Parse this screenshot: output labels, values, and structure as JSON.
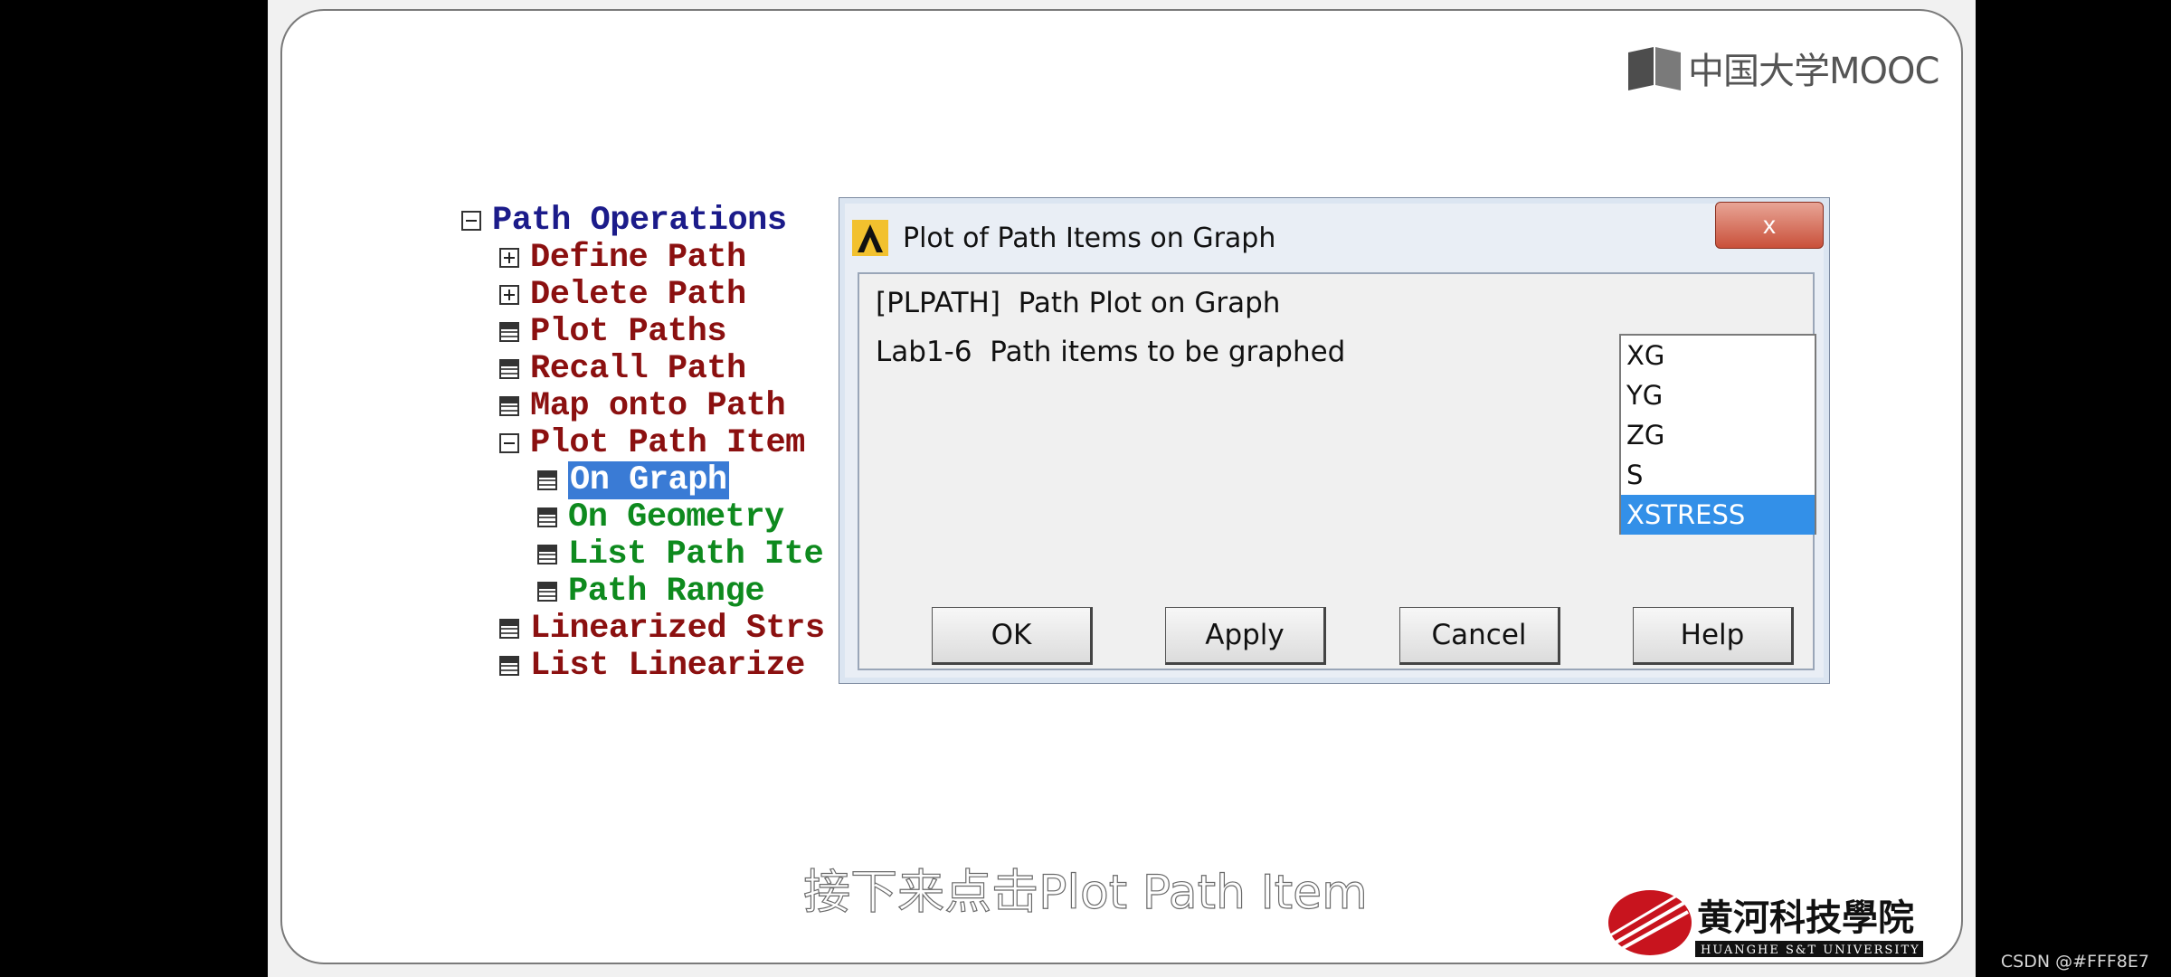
{
  "mooc_logo": {
    "text": "中国大学MOOC"
  },
  "tree": {
    "items": [
      {
        "label": "Path Operations",
        "icon": "collapse-box-icon"
      },
      {
        "label": "Define Path",
        "icon": "expand-box-icon"
      },
      {
        "label": "Delete Path",
        "icon": "expand-box-icon"
      },
      {
        "label": "Plot Paths",
        "icon": "command-doc-icon"
      },
      {
        "label": "Recall Path",
        "icon": "command-doc-icon"
      },
      {
        "label": "Map onto Path",
        "icon": "command-doc-icon"
      },
      {
        "label": "Plot Path Item",
        "icon": "collapse-box-icon"
      },
      {
        "label": "On Graph",
        "icon": "command-doc-icon"
      },
      {
        "label": "On Geometry",
        "icon": "command-doc-icon"
      },
      {
        "label": "List Path Ite",
        "icon": "command-doc-icon"
      },
      {
        "label": "Path Range",
        "icon": "command-doc-icon"
      },
      {
        "label": "Linearized Strs",
        "icon": "command-doc-icon"
      },
      {
        "label": "List Linearize",
        "icon": "command-doc-icon"
      }
    ],
    "selected_item": "On Graph"
  },
  "dialog": {
    "title": "Plot of Path Items on Graph",
    "close_label": "x",
    "command_label": "[PLPATH]  Path Plot on Graph",
    "lab_label": "Lab1-6  Path items to be graphed",
    "list_options": [
      "XG",
      "YG",
      "ZG",
      "S",
      "XSTRESS"
    ],
    "list_selected": "XSTRESS",
    "buttons": {
      "ok": "OK",
      "apply": "Apply",
      "cancel": "Cancel",
      "help": "Help"
    }
  },
  "subtitle": "接下来点击Plot Path Item",
  "university_logo": {
    "name": "黄河科技學院",
    "english": "HUANGHE S&T UNIVERSITY"
  },
  "watermark": "CSDN @#FFF8E7",
  "colors": {
    "tree_root": "#1b1b8a",
    "tree_branch": "#8b1010",
    "tree_leaf": "#0e8a1e",
    "selection": "#3390e8"
  }
}
